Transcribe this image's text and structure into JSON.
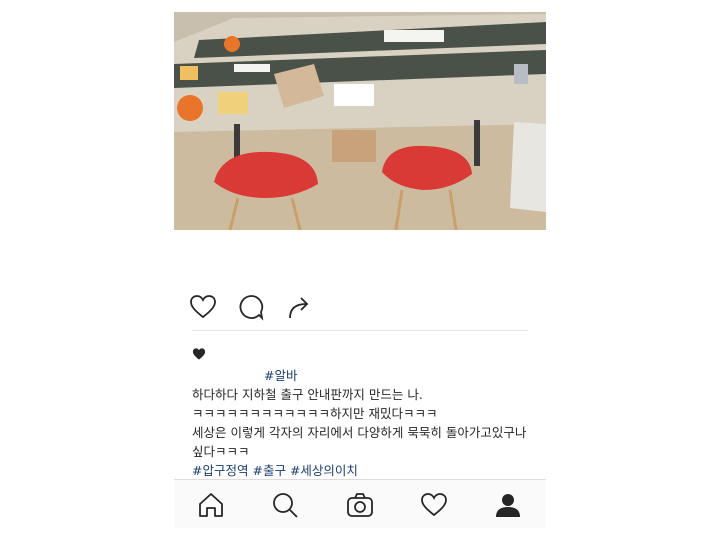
{
  "post": {
    "actions": {
      "like": "heart-icon",
      "comment": "comment-icon",
      "share": "share-icon"
    },
    "likes_icon": "heart-filled-icon",
    "caption": {
      "hashtag_top": "#알바",
      "line1": "하다하다 지하철 출구 안내판까지 만드는 나.",
      "line2": "ㅋㅋㅋㅋㅋㅋㅋㅋㅋㅋㅋㅋ하지만 재밌다ㅋㅋㅋ",
      "line3": "세상은 이렇게 각자의 자리에서 다양하게 묵묵히 돌아가고있구나 싶다ㅋㅋㅋ",
      "hashtags": [
        "#압구정역",
        "#출구",
        "#세상의이치"
      ]
    }
  },
  "navbar": {
    "items": [
      "home-icon",
      "search-icon",
      "camera-icon",
      "activity-heart-icon",
      "profile-icon"
    ]
  },
  "colors": {
    "hashtag": "#1b3e6e",
    "text": "#262626",
    "chair_red": "#d93a35"
  }
}
